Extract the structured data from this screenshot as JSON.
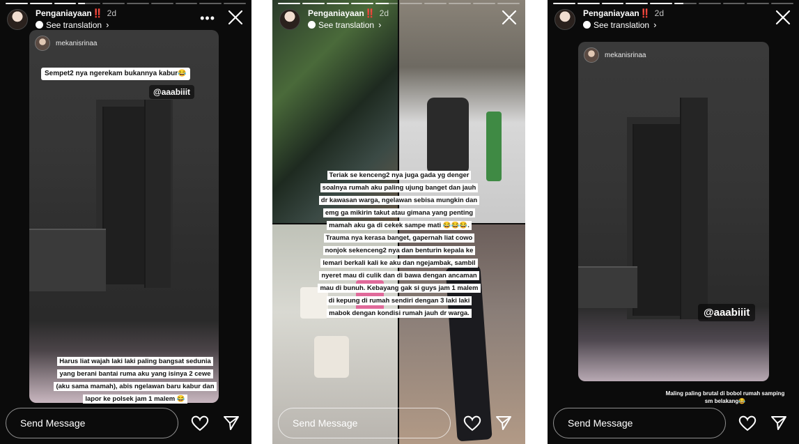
{
  "stories": [
    {
      "username": "Penganiayaan",
      "username_suffix": "‼️",
      "time": "2d",
      "see_translation": "See translation",
      "progress": [
        1,
        1,
        1,
        0.3,
        0,
        0,
        0,
        0,
        0,
        0
      ],
      "reshare_user": "mekanisrinaa",
      "sticker_top": "Sempet2 nya ngerekam bukannya kabur😂",
      "mention": "@aaabiiit",
      "caption_lines": [
        "Harus liat wajah laki laki paling bangsat sedunia",
        "yang berani bantai ruma aku yang isinya 2 cewe",
        "(aku sama mamah), abis ngelawan baru kabur dan",
        "lapor ke polsek jam 1 malem 😂"
      ],
      "message_placeholder": "Send Message"
    },
    {
      "username": "Penganiayaan",
      "username_suffix": "‼️",
      "time": "2d",
      "see_translation": "See translation",
      "progress": [
        1,
        1,
        1,
        1,
        0.6,
        0,
        0,
        0,
        0,
        0
      ],
      "caption_lines": [
        "Teriak se kenceng2 nya juga gada yg denger",
        "soalnya rumah aku paling ujung banget dan jauh",
        "dr kawasan warga, ngelawan sebisa mungkin dan",
        "emg ga mikirin takut atau gimana yang penting",
        "mamah aku ga di cekek sampe mati 😂😂😂.",
        "Trauma nya kerasa banget, gapernah liat cowo",
        "nonjok sekenceng2 nya dan benturin kepala ke",
        "lemari berkali kali ke aku dan ngejambak, sambil",
        "nyeret mau di culik dan di bawa dengan ancaman",
        "mau di bunuh. Kebayang gak si guys jam 1 malem",
        "di kepung di rumah sendiri dengan 3 laki laki",
        "mabok dengan kondisi rumah jauh dr warga."
      ],
      "message_placeholder": "Send Message"
    },
    {
      "username": "Penganiayaan",
      "username_suffix": "‼️",
      "time": "2d",
      "see_translation": "See translation",
      "progress": [
        1,
        1,
        1,
        1,
        1,
        0.4,
        0,
        0,
        0,
        0
      ],
      "reshare_user": "mekanisrinaa",
      "mention": "@aaabiiit",
      "caption_lines": [
        "Maling paling brutal di bobol rumah samping",
        "sm belakang😂"
      ],
      "message_placeholder": "Send Message"
    }
  ]
}
